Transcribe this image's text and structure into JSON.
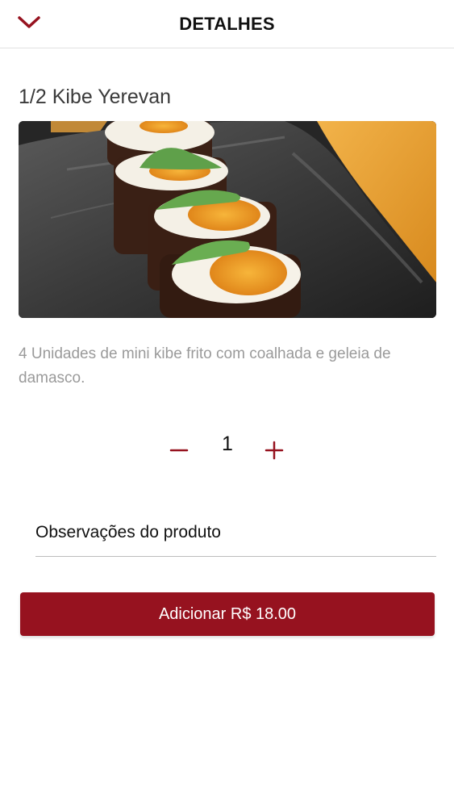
{
  "header": {
    "title": "DETALHES",
    "back_icon": "chevron-down-icon"
  },
  "product": {
    "name": "1/2 Kibe Yerevan",
    "description": "4 Unidades de mini kibe frito com coalhada e geleia de damasco."
  },
  "quantity": {
    "value": "1",
    "minus_icon": "minus-icon",
    "plus_icon": "plus-icon"
  },
  "notes": {
    "placeholder": "Observações do produto"
  },
  "add_button": {
    "label": "Adicionar R$ 18.00"
  },
  "colors": {
    "accent": "#96121f",
    "muted_text": "#9a9a9a"
  }
}
